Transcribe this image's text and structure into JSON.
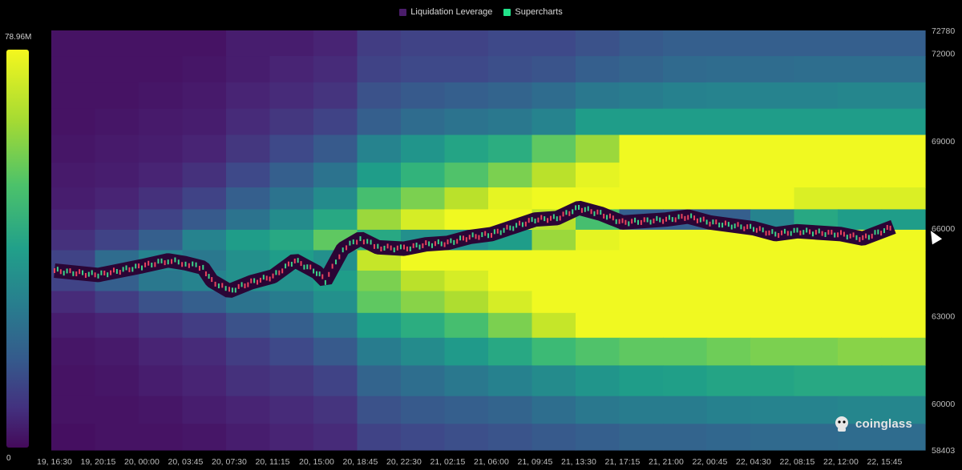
{
  "legend": {
    "items": [
      {
        "label": "Liquidation Leverage",
        "color": "#4b1d6b"
      },
      {
        "label": "Supercharts",
        "color": "#22e38a"
      }
    ]
  },
  "colorbar": {
    "max_label": "78.96M",
    "min_label": "0"
  },
  "watermark": {
    "text": "coinglass"
  },
  "chart_data": {
    "type": "heatmap",
    "title": "",
    "legend": [
      "Liquidation Leverage",
      "Supercharts"
    ],
    "x_tick_labels": [
      "19, 16:30",
      "19, 20:15",
      "20, 00:00",
      "20, 03:45",
      "20, 07:30",
      "20, 11:15",
      "20, 15:00",
      "20, 18:45",
      "20, 22:30",
      "21, 02:15",
      "21, 06:00",
      "21, 09:45",
      "21, 13:30",
      "21, 17:15",
      "21, 21:00",
      "22, 00:45",
      "22, 04:30",
      "22, 08:15",
      "22, 12:00",
      "22, 15:45"
    ],
    "y_tick_labels": [
      "72780",
      "72000",
      "69000",
      "66000",
      "63000",
      "60000",
      "58403"
    ],
    "y_tick_values": [
      72780,
      72000,
      69000,
      66000,
      63000,
      60000,
      58403
    ],
    "ylim": [
      58403,
      72780
    ],
    "colorscale": {
      "min": 0,
      "max": 78960000,
      "unit": "USD",
      "scheme": "viridis"
    },
    "price_series": {
      "name": "",
      "x_index": [
        0,
        1,
        2,
        2.6,
        3,
        3.4,
        3.6,
        4,
        4.5,
        5,
        5.5,
        6,
        6.2,
        6.6,
        7,
        7.4,
        8,
        8.5,
        9,
        9.5,
        10,
        10.5,
        11,
        11.5,
        12,
        12.5,
        13,
        13.5,
        14,
        14.5,
        15,
        15.5,
        16,
        16.5,
        17,
        17.5,
        18,
        18.5,
        19.2
      ],
      "close": [
        64550,
        64400,
        64700,
        64900,
        64800,
        64650,
        64200,
        63850,
        64150,
        64350,
        64900,
        64500,
        64200,
        65300,
        65650,
        65350,
        65300,
        65450,
        65500,
        65700,
        65800,
        66050,
        66300,
        66350,
        66700,
        66500,
        66200,
        66250,
        66300,
        66400,
        66200,
        66100,
        66000,
        65800,
        65900,
        65850,
        65800,
        65650,
        66050
      ]
    },
    "bands": [
      {
        "y": 72300,
        "intensity": [
          0.05,
          0.05,
          0.05,
          0.05,
          0.08,
          0.08,
          0.1,
          0.18,
          0.2,
          0.2,
          0.22,
          0.22,
          0.25,
          0.28,
          0.3,
          0.3,
          0.3,
          0.3,
          0.3,
          0.3
        ]
      },
      {
        "y": 71500,
        "intensity": [
          0.05,
          0.05,
          0.05,
          0.06,
          0.08,
          0.1,
          0.12,
          0.2,
          0.22,
          0.22,
          0.24,
          0.26,
          0.3,
          0.32,
          0.34,
          0.35,
          0.35,
          0.36,
          0.36,
          0.36
        ]
      },
      {
        "y": 70500,
        "intensity": [
          0.05,
          0.05,
          0.06,
          0.07,
          0.1,
          0.12,
          0.15,
          0.25,
          0.28,
          0.3,
          0.32,
          0.35,
          0.4,
          0.42,
          0.44,
          0.45,
          0.45,
          0.45,
          0.46,
          0.46
        ]
      },
      {
        "y": 69700,
        "intensity": [
          0.05,
          0.06,
          0.07,
          0.08,
          0.12,
          0.16,
          0.2,
          0.3,
          0.35,
          0.38,
          0.4,
          0.45,
          0.55,
          0.55,
          0.55,
          0.55,
          0.55,
          0.55,
          0.55,
          0.55
        ]
      },
      {
        "y": 68700,
        "intensity": [
          0.06,
          0.07,
          0.08,
          0.1,
          0.16,
          0.22,
          0.28,
          0.45,
          0.52,
          0.58,
          0.62,
          0.75,
          0.85,
          1,
          1,
          1,
          1,
          1,
          1,
          1
        ]
      },
      {
        "y": 67800,
        "intensity": [
          0.07,
          0.08,
          0.1,
          0.14,
          0.22,
          0.3,
          0.38,
          0.55,
          0.65,
          0.72,
          0.8,
          0.9,
          0.98,
          1,
          1,
          1,
          1,
          1,
          1,
          1
        ]
      },
      {
        "y": 67000,
        "intensity": [
          0.08,
          0.1,
          0.14,
          0.2,
          0.3,
          0.38,
          0.48,
          0.7,
          0.8,
          0.9,
          0.98,
          1,
          1,
          1,
          1,
          1,
          1,
          0.96,
          0.96,
          0.96
        ]
      },
      {
        "y": 66300,
        "intensity": [
          0.1,
          0.14,
          0.2,
          0.28,
          0.38,
          0.48,
          0.6,
          0.85,
          0.95,
          1,
          1,
          0.9,
          0.7,
          0.3,
          0.3,
          0.3,
          0.45,
          0.6,
          0.55,
          0.55
        ]
      },
      {
        "y": 65600,
        "intensity": [
          0.14,
          0.2,
          0.3,
          0.45,
          0.55,
          0.6,
          0.75,
          0.6,
          0.5,
          0.5,
          0.55,
          0.85,
          0.98,
          1,
          1,
          1,
          1,
          1,
          1,
          1
        ]
      },
      {
        "y": 64900,
        "intensity": [
          0.2,
          0.35,
          0.45,
          0.4,
          0.5,
          0.55,
          0.5,
          0.92,
          1,
          1,
          1,
          1,
          1,
          1,
          1,
          1,
          1,
          1,
          1,
          1
        ]
      },
      {
        "y": 64200,
        "intensity": [
          0.2,
          0.3,
          0.4,
          0.45,
          0.5,
          0.5,
          0.55,
          0.8,
          0.9,
          0.95,
          1,
          1,
          1,
          1,
          1,
          1,
          1,
          1,
          1,
          1
        ]
      },
      {
        "y": 63500,
        "intensity": [
          0.12,
          0.18,
          0.25,
          0.3,
          0.38,
          0.42,
          0.5,
          0.75,
          0.82,
          0.88,
          0.95,
          1,
          1,
          1,
          1,
          1,
          1,
          1,
          1,
          1
        ]
      },
      {
        "y": 62700,
        "intensity": [
          0.08,
          0.1,
          0.14,
          0.18,
          0.25,
          0.3,
          0.38,
          0.55,
          0.62,
          0.7,
          0.8,
          0.92,
          1,
          1,
          1,
          1,
          1,
          1,
          1,
          1
        ]
      },
      {
        "y": 61800,
        "intensity": [
          0.06,
          0.07,
          0.1,
          0.12,
          0.18,
          0.22,
          0.28,
          0.42,
          0.48,
          0.54,
          0.6,
          0.68,
          0.72,
          0.75,
          0.75,
          0.78,
          0.8,
          0.8,
          0.82,
          0.82
        ]
      },
      {
        "y": 60800,
        "intensity": [
          0.05,
          0.06,
          0.08,
          0.1,
          0.14,
          0.16,
          0.2,
          0.32,
          0.36,
          0.4,
          0.44,
          0.48,
          0.52,
          0.55,
          0.56,
          0.58,
          0.58,
          0.6,
          0.6,
          0.6
        ]
      },
      {
        "y": 59700,
        "intensity": [
          0.05,
          0.05,
          0.06,
          0.08,
          0.1,
          0.12,
          0.15,
          0.25,
          0.28,
          0.3,
          0.32,
          0.36,
          0.4,
          0.42,
          0.42,
          0.44,
          0.45,
          0.45,
          0.46,
          0.46
        ]
      },
      {
        "y": 58900,
        "intensity": [
          0.04,
          0.05,
          0.05,
          0.06,
          0.08,
          0.1,
          0.12,
          0.2,
          0.22,
          0.24,
          0.26,
          0.28,
          0.3,
          0.32,
          0.32,
          0.33,
          0.34,
          0.34,
          0.35,
          0.35
        ]
      }
    ]
  }
}
